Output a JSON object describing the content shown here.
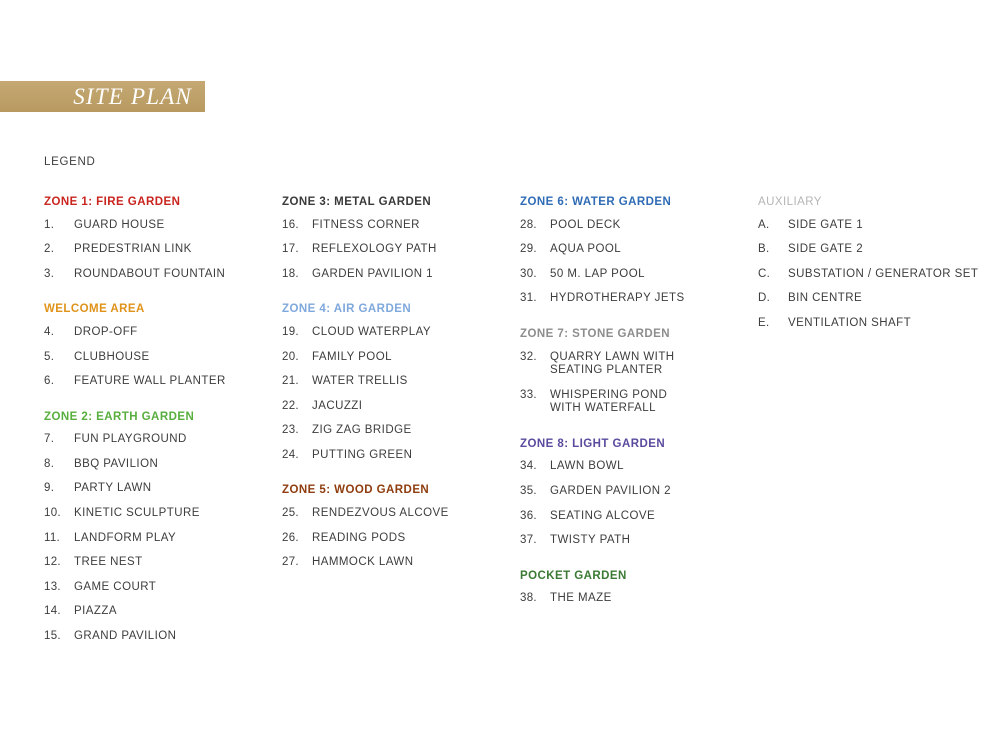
{
  "title": "SITE PLAN",
  "legend_label": "LEGEND",
  "colors": {
    "band_gold": "#bfa16a",
    "title_text": "#ffffff",
    "body_text": "#3d3d3d",
    "zone1_red": "#c9241e",
    "welcome_orange": "#e0931a",
    "zone2_green": "#58ae3e",
    "zone3_dark": "#3a3a3a",
    "zone4_lightblue": "#7fa8dc",
    "zone5_brown": "#8f3c0e",
    "zone6_blue": "#2f6cb5",
    "zone7_gray": "#8d8d8d",
    "zone8_purple": "#5b4a9e",
    "pocket_green": "#3b7a34",
    "auxiliary_gray": "#b5b5b5"
  },
  "columns": [
    {
      "id": "column-1",
      "groups": [
        {
          "id": "zone-1-fire-garden",
          "heading": "ZONE 1: FIRE GARDEN",
          "heading_color": "#c9241e",
          "heading_bold": true,
          "items": [
            {
              "num": "1.",
              "label": "GUARD HOUSE"
            },
            {
              "num": "2.",
              "label": "PREDESTRIAN LINK"
            },
            {
              "num": "3.",
              "label": "ROUNDABOUT FOUNTAIN"
            }
          ]
        },
        {
          "id": "welcome-area",
          "heading": "WELCOME AREA",
          "heading_color": "#e0931a",
          "heading_bold": true,
          "items": [
            {
              "num": "4.",
              "label": "DROP-OFF"
            },
            {
              "num": "5.",
              "label": "CLUBHOUSE"
            },
            {
              "num": "6.",
              "label": "FEATURE WALL PLANTER"
            }
          ]
        },
        {
          "id": "zone-2-earth-garden",
          "heading": "ZONE 2: EARTH GARDEN",
          "heading_color": "#58ae3e",
          "heading_bold": true,
          "items": [
            {
              "num": "7.",
              "label": "FUN PLAYGROUND"
            },
            {
              "num": "8.",
              "label": "BBQ PAVILION"
            },
            {
              "num": "9.",
              "label": "PARTY LAWN"
            },
            {
              "num": "10.",
              "label": "KINETIC SCULPTURE"
            },
            {
              "num": "11.",
              "label": "LANDFORM PLAY"
            },
            {
              "num": "12.",
              "label": "TREE NEST"
            },
            {
              "num": "13.",
              "label": "GAME COURT"
            },
            {
              "num": "14.",
              "label": "PIAZZA"
            },
            {
              "num": "15.",
              "label": "GRAND PAVILION"
            }
          ]
        }
      ]
    },
    {
      "id": "column-2",
      "groups": [
        {
          "id": "zone-3-metal-garden",
          "heading": "ZONE 3: METAL GARDEN",
          "heading_color": "#3a3a3a",
          "heading_bold": true,
          "items": [
            {
              "num": "16.",
              "label": "FITNESS CORNER"
            },
            {
              "num": "17.",
              "label": "REFLEXOLOGY PATH"
            },
            {
              "num": "18.",
              "label": "GARDEN PAVILION 1"
            }
          ]
        },
        {
          "id": "zone-4-air-garden",
          "heading": "ZONE 4: AIR GARDEN",
          "heading_color": "#7fa8dc",
          "heading_bold": true,
          "items": [
            {
              "num": "19.",
              "label": "CLOUD WATERPLAY"
            },
            {
              "num": "20.",
              "label": "FAMILY POOL"
            },
            {
              "num": "21.",
              "label": "WATER TRELLIS"
            },
            {
              "num": "22.",
              "label": "JACUZZI"
            },
            {
              "num": "23.",
              "label": "ZIG ZAG BRIDGE"
            },
            {
              "num": "24.",
              "label": "PUTTING GREEN"
            }
          ]
        },
        {
          "id": "zone-5-wood-garden",
          "heading": "ZONE 5: WOOD GARDEN",
          "heading_color": "#8f3c0e",
          "heading_bold": true,
          "items": [
            {
              "num": "25.",
              "label": "RENDEZVOUS ALCOVE"
            },
            {
              "num": "26.",
              "label": "READING PODS"
            },
            {
              "num": "27.",
              "label": "HAMMOCK LAWN"
            }
          ]
        }
      ]
    },
    {
      "id": "column-3",
      "groups": [
        {
          "id": "zone-6-water-garden",
          "heading": "ZONE 6: WATER GARDEN",
          "heading_color": "#2f6cb5",
          "heading_bold": true,
          "items": [
            {
              "num": "28.",
              "label": "POOL DECK"
            },
            {
              "num": "29.",
              "label": "AQUA POOL"
            },
            {
              "num": "30.",
              "label": "50 M. LAP POOL"
            },
            {
              "num": "31.",
              "label": "HYDROTHERAPY JETS"
            }
          ]
        },
        {
          "id": "zone-7-stone-garden",
          "heading": "ZONE 7: STONE GARDEN",
          "heading_color": "#8d8d8d",
          "heading_bold": true,
          "items": [
            {
              "num": "32.",
              "label": "QUARRY LAWN WITH",
              "label2": "SEATING PLANTER"
            },
            {
              "num": "33.",
              "label": "WHISPERING POND",
              "label2": "WITH WATERFALL"
            }
          ]
        },
        {
          "id": "zone-8-light-garden",
          "heading": "ZONE 8: LIGHT GARDEN",
          "heading_color": "#5b4a9e",
          "heading_bold": true,
          "items": [
            {
              "num": "34.",
              "label": "LAWN BOWL"
            },
            {
              "num": "35.",
              "label": "GARDEN PAVILION 2"
            },
            {
              "num": "36.",
              "label": "SEATING ALCOVE"
            },
            {
              "num": "37.",
              "label": "TWISTY PATH"
            }
          ]
        },
        {
          "id": "pocket-garden",
          "heading": "POCKET GARDEN",
          "heading_color": "#3b7a34",
          "heading_bold": true,
          "items": [
            {
              "num": "38.",
              "label": "THE MAZE"
            }
          ]
        }
      ]
    },
    {
      "id": "column-4",
      "groups": [
        {
          "id": "auxiliary",
          "heading": "AUXILIARY",
          "heading_color": "#b5b5b5",
          "heading_bold": false,
          "items": [
            {
              "num": "A.",
              "label": "SIDE GATE 1"
            },
            {
              "num": "B.",
              "label": "SIDE GATE 2"
            },
            {
              "num": "C.",
              "label": "SUBSTATION / GENERATOR SET"
            },
            {
              "num": "D.",
              "label": "BIN CENTRE"
            },
            {
              "num": "E.",
              "label": "VENTILATION SHAFT"
            }
          ]
        }
      ]
    }
  ]
}
